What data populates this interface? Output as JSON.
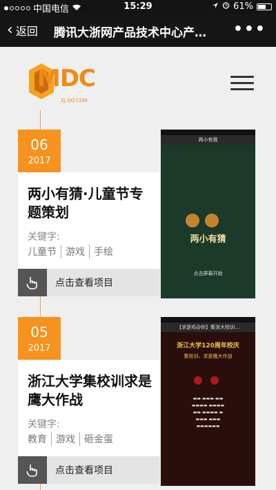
{
  "status": {
    "carrier": "中国电信",
    "time": "15:29",
    "battery": "61%",
    "battery_level": 0.61
  },
  "nav": {
    "back_label": "返回",
    "title": "腾讯大浙网产品技术中心产…",
    "more": "•••"
  },
  "logo": {
    "text": "MDC",
    "sub": "ZJ.QQ.COM"
  },
  "projects": [
    {
      "month": "06",
      "year": "2017",
      "title": "两小有猜·儿童节专题策划",
      "keywords_label": "关键字:",
      "tags": [
        "儿童节",
        "游戏",
        "手绘"
      ],
      "cta": "点击查看项目",
      "thumb": {
        "nav_title": "两小有猜",
        "art_title": "两小有猜",
        "start_text": "点击屏幕开始"
      }
    },
    {
      "month": "05",
      "year": "2017",
      "title": "浙江大学集校训求是鹰大作战",
      "keywords_label": "关键字:",
      "tags": [
        "教育",
        "游戏",
        "砸金蛋"
      ],
      "cta": "点击查看项目",
      "thumb": {
        "nav_title": "【求是鸡@你】集浙大校训...",
        "headline": "浙江大学120周年校庆",
        "subline": "集校训，求是鹰大作战"
      }
    }
  ]
}
